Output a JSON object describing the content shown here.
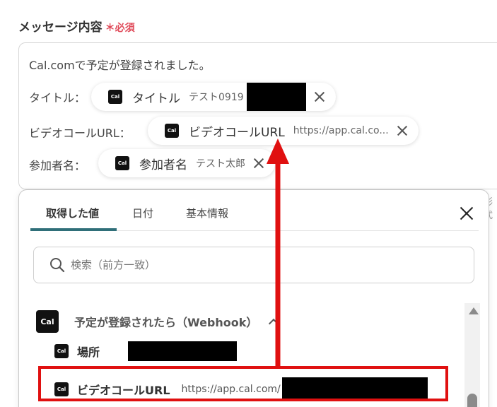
{
  "field": {
    "label": "メッセージ内容",
    "required_mark": "＊",
    "required_text": "必須"
  },
  "editor": {
    "intro": "Cal.comで予定が登録されました。",
    "rows": [
      {
        "label": "タイトル：",
        "chip_name": "タイトル",
        "chip_value": "テスト0919"
      },
      {
        "label": "ビデオコールURL：",
        "chip_name": "ビデオコールURL",
        "chip_value": "https://app.cal.co..."
      },
      {
        "label": "参加者名：",
        "chip_name": "参加者名",
        "chip_value": "テスト太郎"
      }
    ],
    "icon_text": "Cal"
  },
  "side_text": "形式",
  "panel": {
    "tabs": [
      {
        "label": "取得した値"
      },
      {
        "label": "日付"
      },
      {
        "label": "基本情報"
      }
    ],
    "search_placeholder": "検索（前方一致）",
    "group": {
      "icon_text": "Cal",
      "title": "予定が登録されたら（Webhook）"
    },
    "items": [
      {
        "name": "場所",
        "value": ""
      },
      {
        "name": "ビデオコールURL",
        "value": "https://app.cal.com/"
      }
    ]
  },
  "colors": {
    "accent_tab": "#2f6f79",
    "required": "#e04b5a",
    "annotation": "#e01010"
  },
  "icons": [
    "cal-icon",
    "close-icon",
    "search-icon",
    "chevron-up-icon"
  ]
}
